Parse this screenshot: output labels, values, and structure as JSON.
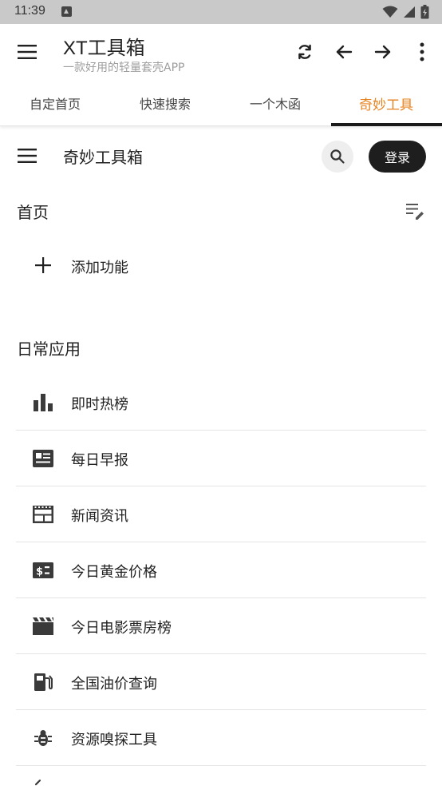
{
  "status_bar": {
    "time": "11:39",
    "icons": [
      "notification-icon",
      "wifi-icon",
      "signal-icon",
      "battery-icon"
    ]
  },
  "app_bar": {
    "title": "XT工具箱",
    "subtitle": "一款好用的轻量套壳APP",
    "actions": [
      "refresh-icon",
      "back-arrow-icon",
      "forward-arrow-icon",
      "more-vert-icon"
    ]
  },
  "tabs": [
    {
      "label": "自定首页",
      "active": false
    },
    {
      "label": "快速搜索",
      "active": false
    },
    {
      "label": "一个木函",
      "active": false
    },
    {
      "label": "奇妙工具",
      "active": true
    }
  ],
  "inner_header": {
    "title": "奇妙工具箱",
    "login_label": "登录"
  },
  "home_section": {
    "title": "首页",
    "add_label": "添加功能"
  },
  "daily_section": {
    "title": "日常应用",
    "items": [
      {
        "label": "即时热榜",
        "icon": "bar-chart-icon"
      },
      {
        "label": "每日早报",
        "icon": "newspaper-icon"
      },
      {
        "label": "新闻资讯",
        "icon": "news-feed-icon"
      },
      {
        "label": "今日黄金价格",
        "icon": "price-tag-icon"
      },
      {
        "label": "今日电影票房榜",
        "icon": "movie-clapper-icon"
      },
      {
        "label": "全国油价查询",
        "icon": "gas-station-icon"
      },
      {
        "label": "资源嗅探工具",
        "icon": "bug-icon"
      }
    ]
  },
  "colors": {
    "accent": "#e6821e",
    "tab_indicator": "#1a1a1a",
    "login_button": "#1e1e1e",
    "status_bar": "#c9c9c9"
  }
}
